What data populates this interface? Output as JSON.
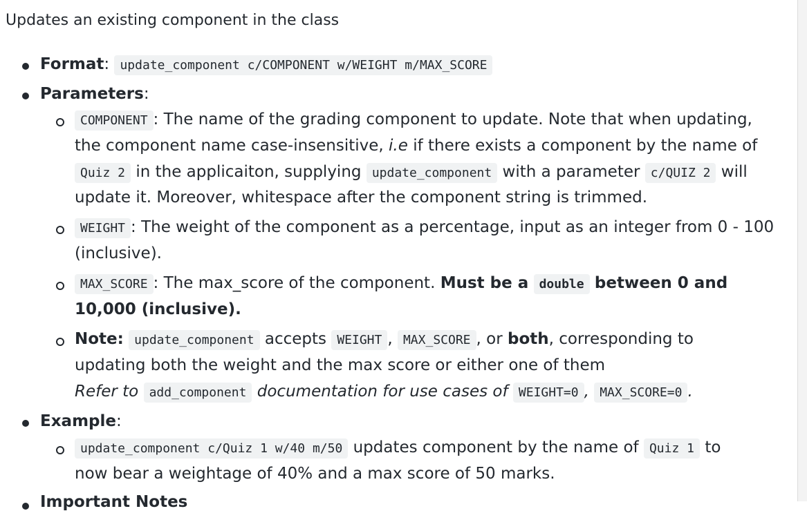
{
  "intro": "Updates an existing component in the class",
  "format": {
    "label": "Format",
    "colon": ":",
    "command": "update_component c/COMPONENT w/WEIGHT m/MAX_SCORE"
  },
  "parameters": {
    "label": "Parameters",
    "colon": ":",
    "component": {
      "code": "COMPONENT",
      "l1": ": The name of the grading component to update. Note that when updating,",
      "l2a": "the component name case-insensitive,",
      "l2ie": "i.e",
      "l2b": "if there exists a component by the name of",
      "quiz": "Quiz 2",
      "l3a": "in the applicaiton, supplying",
      "cmd": "update_component",
      "l3b": "with a parameter",
      "param": "c/QUIZ 2",
      "l3c": "will",
      "l4": "update it. Moreover, whitespace after the component string is trimmed."
    },
    "weight": {
      "code": "WEIGHT",
      "l1": ": The weight of the component as a percentage, input as an integer from 0 - 100",
      "l2": "(inclusive)."
    },
    "max_score": {
      "code": "MAX_SCORE",
      "l1": ": The max_score of the component.",
      "must": "Must be a",
      "type": "double",
      "between": "between 0 and",
      "l2": "10,000 (inclusive)."
    },
    "note": {
      "label": "Note:",
      "cmd": "update_component",
      "accepts": "accepts",
      "w": "WEIGHT",
      "comma": ",",
      "m": "MAX_SCORE",
      "or": ", or",
      "both": "both",
      "rest": ", corresponding to",
      "l2": "updating both the weight and the max score or either one of them",
      "l3a": "Refer to",
      "addcmd": "add_component",
      "l3b": "documentation for use cases of",
      "w0": "WEIGHT=0",
      "comma2": ",",
      "m0": "MAX_SCORE=0",
      "dot": "."
    }
  },
  "example": {
    "label": "Example",
    "colon": ":",
    "cmd": "update_component c/Quiz 1 w/40 m/50",
    "l1": "updates component by the name of",
    "quiz": "Quiz 1",
    "to": "to",
    "l2": "now bear a weightage of 40% and a max score of 50 marks."
  },
  "next_heading": "Important Notes"
}
